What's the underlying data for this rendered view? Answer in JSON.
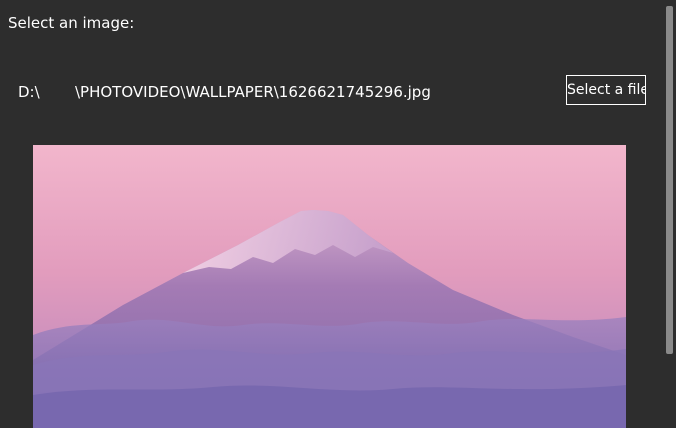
{
  "prompt": {
    "label": "Select an image:"
  },
  "file_path": {
    "drive": "D:\\",
    "rest": "\\PHOTOVIDEO\\WALLPAPER\\1626621745296.jpg"
  },
  "select_button": {
    "label": "Select a file"
  },
  "preview": {
    "description_icon": "mountain-landscape-image"
  },
  "colors": {
    "background": "#2d2d2d",
    "text": "#ffffff",
    "scrollbar_thumb": "#8a8a8a",
    "sky_top": "#f2b3c9",
    "sky_bottom": "#b07bb8",
    "mountain": "#8a6aaa",
    "clouds": "#8d78b8"
  }
}
